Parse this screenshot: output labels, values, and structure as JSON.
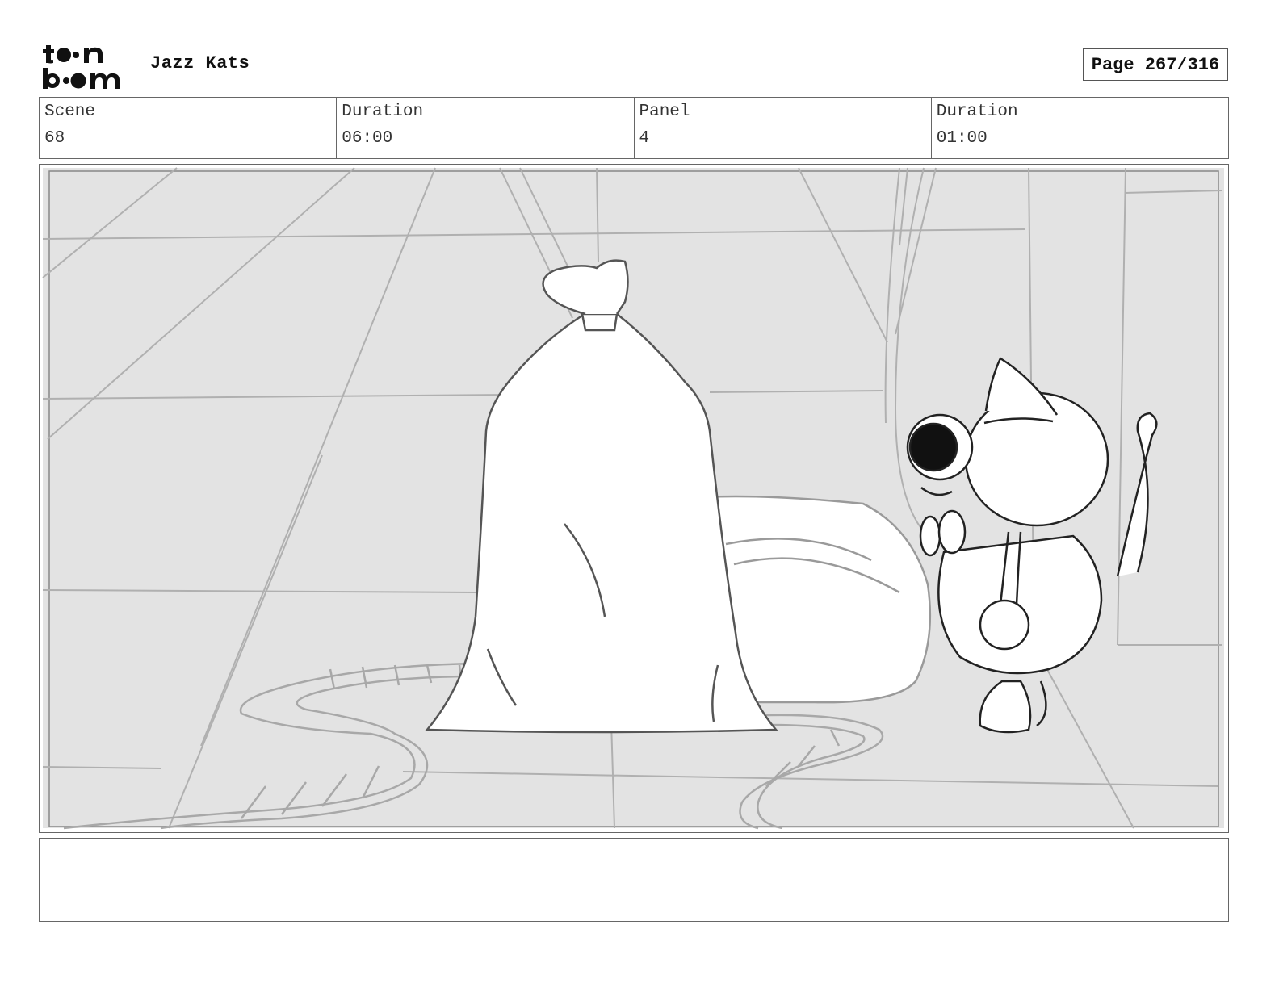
{
  "header": {
    "logo": {
      "line1": "toon",
      "line2": "boom"
    },
    "project_title": "Jazz Kats",
    "page_indicator": "Page 267/316"
  },
  "info": {
    "scene_label": "Scene",
    "scene_value": "68",
    "scene_duration_label": "Duration",
    "scene_duration_value": "06:00",
    "panel_label": "Panel",
    "panel_value": "4",
    "panel_duration_label": "Duration",
    "panel_duration_value": "01:00"
  },
  "panel": {
    "background_color": "#e3e3e3",
    "line_color": "#b0b0b0"
  },
  "notes": {
    "text": ""
  }
}
